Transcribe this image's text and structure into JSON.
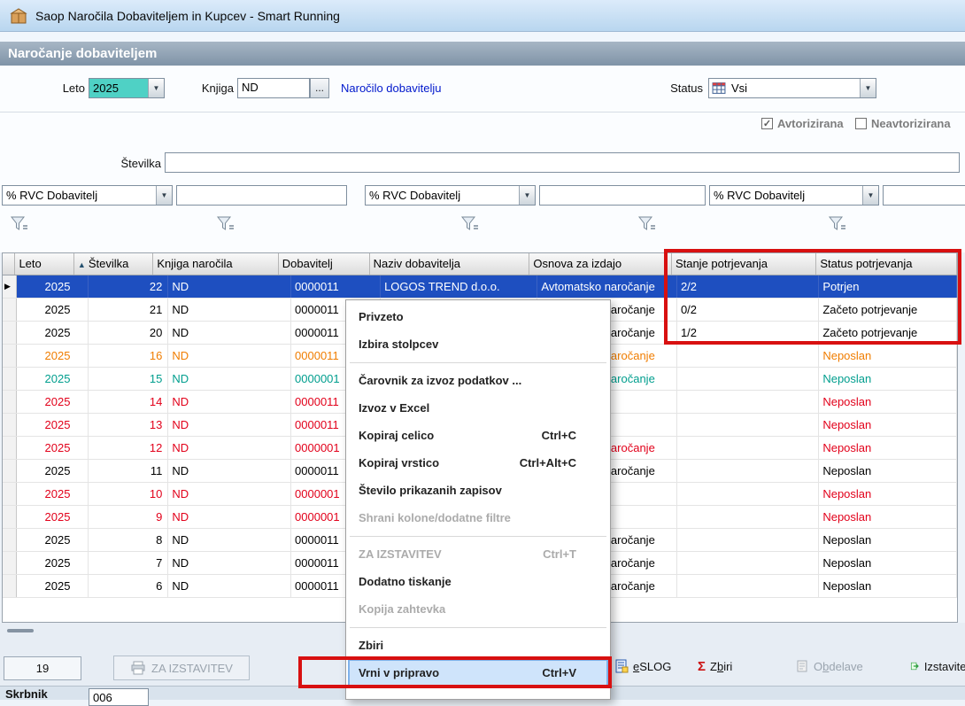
{
  "title_bar": {
    "title": "Saop  Naročila Dobaviteljem in Kupcev - Smart Running"
  },
  "section_header": {
    "title": "Naročanje dobaviteljem"
  },
  "icons": {
    "dropdown_arrow": "▼",
    "sort_asc": "▲",
    "row_pointer": "▶",
    "check": "✓",
    "sigma": "Σ"
  },
  "filters": {
    "leto_label": "Leto",
    "leto_value": "2025",
    "knjiga_label": "Knjiga",
    "knjiga_value": "ND",
    "browse_label": "...",
    "order_link": "Naročilo dobavitelju",
    "status_label": "Status",
    "status_value": "Vsi",
    "checkbox_avtorizirana": "Avtorizirana",
    "checkbox_neavtorizirana": "Neavtorizirana",
    "stevilka_label": "Številka",
    "stevilka_value": "",
    "rvc_label": "% RVC Dobavitelj",
    "rvc_value_1": "",
    "rvc_value_2": "",
    "rvc_value_3": ""
  },
  "table": {
    "columns": [
      "Leto",
      "Številka",
      "Knjiga naročila",
      "Dobavitelj",
      "Naziv dobavitelja",
      "Osnova za izdajo",
      "Stanje potrjevanja",
      "Status potrjevanja"
    ],
    "sort_column": "Številka",
    "rows": [
      {
        "leto": "2025",
        "stevilka": "22",
        "knjiga": "ND",
        "dobavitelj": "0000011",
        "naziv": "LOGOS TREND d.o.o.",
        "osnova": "Avtomatsko naročanje",
        "stanje": "2/2",
        "status": "Potrjen",
        "color": "selected"
      },
      {
        "leto": "2025",
        "stevilka": "21",
        "knjiga": "ND",
        "dobavitelj": "0000011",
        "naziv": "",
        "osnova": "Avtomatsko naročanje",
        "stanje": "0/2",
        "status": "Začeto potrjevanje",
        "color": "default"
      },
      {
        "leto": "2025",
        "stevilka": "20",
        "knjiga": "ND",
        "dobavitelj": "0000011",
        "naziv": "",
        "osnova": "Avtomatsko naročanje",
        "stanje": "1/2",
        "status": "Začeto potrjevanje",
        "color": "default"
      },
      {
        "leto": "2025",
        "stevilka": "16",
        "knjiga": "ND",
        "dobavitelj": "0000011",
        "naziv": "",
        "osnova": "Avtomatsko naročanje",
        "stanje": "",
        "status": "Neposlan",
        "color": "orange"
      },
      {
        "leto": "2025",
        "stevilka": "15",
        "knjiga": "ND",
        "dobavitelj": "0000001",
        "naziv": "",
        "osnova": "Avtomatsko naročanje",
        "stanje": "",
        "status": "Neposlan",
        "color": "teal"
      },
      {
        "leto": "2025",
        "stevilka": "14",
        "knjiga": "ND",
        "dobavitelj": "0000011",
        "naziv": "",
        "osnova": "",
        "stanje": "",
        "status": "Neposlan",
        "color": "red"
      },
      {
        "leto": "2025",
        "stevilka": "13",
        "knjiga": "ND",
        "dobavitelj": "0000011",
        "naziv": "",
        "osnova": "",
        "stanje": "",
        "status": "Neposlan",
        "color": "red"
      },
      {
        "leto": "2025",
        "stevilka": "12",
        "knjiga": "ND",
        "dobavitelj": "0000001",
        "naziv": "",
        "osnova": "Avtomatsko naročanje",
        "stanje": "",
        "status": "Neposlan",
        "color": "red"
      },
      {
        "leto": "2025",
        "stevilka": "11",
        "knjiga": "ND",
        "dobavitelj": "0000011",
        "naziv": "",
        "osnova": "Avtomatsko naročanje",
        "stanje": "",
        "status": "Neposlan",
        "color": "default"
      },
      {
        "leto": "2025",
        "stevilka": "10",
        "knjiga": "ND",
        "dobavitelj": "0000001",
        "naziv": "",
        "osnova": "",
        "stanje": "",
        "status": "Neposlan",
        "color": "red"
      },
      {
        "leto": "2025",
        "stevilka": "9",
        "knjiga": "ND",
        "dobavitelj": "0000001",
        "naziv": "",
        "osnova": "",
        "stanje": "",
        "status": "Neposlan",
        "color": "red"
      },
      {
        "leto": "2025",
        "stevilka": "8",
        "knjiga": "ND",
        "dobavitelj": "0000011",
        "naziv": "",
        "osnova": "Avtomatsko naročanje",
        "stanje": "",
        "status": "Neposlan",
        "color": "default"
      },
      {
        "leto": "2025",
        "stevilka": "7",
        "knjiga": "ND",
        "dobavitelj": "0000011",
        "naziv": "",
        "osnova": "Avtomatsko naročanje",
        "stanje": "",
        "status": "Neposlan",
        "color": "default"
      },
      {
        "leto": "2025",
        "stevilka": "6",
        "knjiga": "ND",
        "dobavitelj": "0000011",
        "naziv": "",
        "osnova": "Avtomatsko naročanje",
        "stanje": "",
        "status": "Neposlan",
        "color": "default"
      }
    ]
  },
  "row_colors": {
    "default": "#000000",
    "red": "#e2001a",
    "orange": "#f07d00",
    "teal": "#009e8e",
    "selected_bg": "#1e4fc0"
  },
  "context_menu": {
    "items": [
      {
        "label": "Privzeto"
      },
      {
        "label": "Izbira stolpcev"
      },
      {
        "separator": true
      },
      {
        "label": "Čarovnik za izvoz podatkov ..."
      },
      {
        "label": "Izvoz v Excel"
      },
      {
        "label": "Kopiraj celico",
        "shortcut": "Ctrl+C"
      },
      {
        "label": "Kopiraj vrstico",
        "shortcut": "Ctrl+Alt+C"
      },
      {
        "label": "Število prikazanih zapisov"
      },
      {
        "label": "Shrani kolone/dodatne filtre",
        "disabled": true
      },
      {
        "separator": true
      },
      {
        "label": "ZA IZSTAVITEV",
        "shortcut": "Ctrl+T",
        "disabled": true
      },
      {
        "label": "Dodatno tiskanje"
      },
      {
        "label": "Kopija zahtevka",
        "disabled": true
      },
      {
        "separator": true
      },
      {
        "label": "Zbiri"
      },
      {
        "label": "Vrni v pripravo",
        "shortcut": "Ctrl+V",
        "highlighted": true
      }
    ]
  },
  "toolbar": {
    "count": "19",
    "za_izstavitev": "ZA IZSTAVITEV",
    "eslog": {
      "pre": "",
      "key": "e",
      "post": "SLOG"
    },
    "zbiri": {
      "pre": "Z",
      "key": "b",
      "post": "iri"
    },
    "obdelave": {
      "pre": "O",
      "key": "b",
      "post": "delave"
    },
    "izstavitev": "Izstavitev"
  },
  "status_bar": {
    "user_label": "Skrbnik",
    "value": "006"
  },
  "annotation_color": "#d81010"
}
